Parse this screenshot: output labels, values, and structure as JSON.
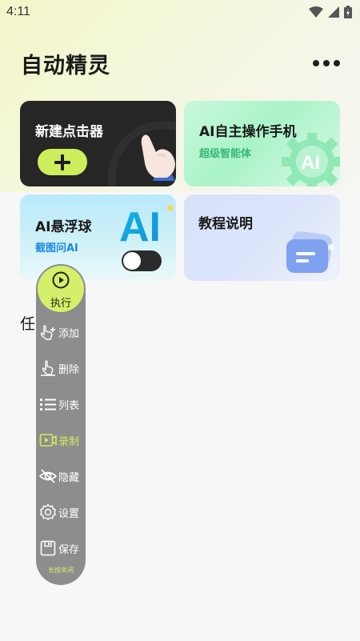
{
  "status_bar": {
    "time": "4:11",
    "icons": [
      "wifi-icon",
      "signal-icon",
      "battery-charging-icon"
    ]
  },
  "header": {
    "title": "自动精灵",
    "more_icon": "more-dots-icon"
  },
  "cards": {
    "new_clicker": {
      "title": "新建点击器",
      "action_icon": "plus-icon",
      "illustration": "pointing-hand-icon"
    },
    "ai_agent": {
      "title": "AI自主操作手机",
      "subtitle": "超级智能体",
      "illustration": "ai-gear-icon"
    },
    "ai_float": {
      "title": "AI悬浮球",
      "subtitle": "截图问AI",
      "logo_text": "AI",
      "toggle_on": false
    },
    "tutorial": {
      "title": "教程说明",
      "illustration": "document-icon"
    }
  },
  "section": {
    "task_list_title": "任务列表"
  },
  "float_panel": {
    "execute": {
      "label": "执行",
      "icon": "play-circle-icon"
    },
    "items": [
      {
        "label": "添加",
        "icon": "tap-add-icon",
        "active": false
      },
      {
        "label": "删除",
        "icon": "swipe-delete-icon",
        "active": false
      },
      {
        "label": "列表",
        "icon": "list-icon",
        "active": false
      },
      {
        "label": "录制",
        "icon": "record-video-icon",
        "active": true
      },
      {
        "label": "隐藏",
        "icon": "eye-off-icon",
        "active": false
      },
      {
        "label": "设置",
        "icon": "gear-icon",
        "active": false
      },
      {
        "label": "保存",
        "icon": "save-icon",
        "active": false
      }
    ],
    "hint": "长按关闭"
  },
  "colors": {
    "accent_lime": "#cdee5a",
    "dark_card": "#262626",
    "green_text": "#37b874",
    "blue_text": "#1e88e5",
    "panel_gray": "#8d8d8d"
  }
}
